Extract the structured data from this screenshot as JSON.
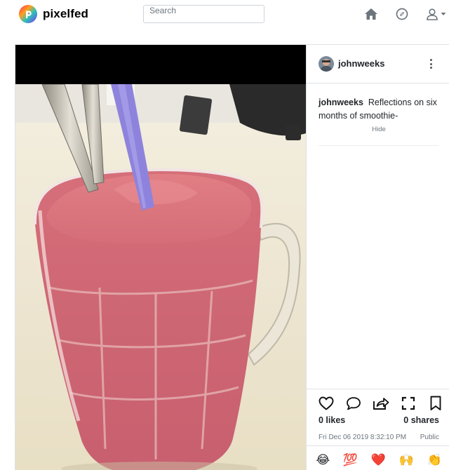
{
  "navbar": {
    "brand": "pixelfed",
    "search": {
      "placeholder": "Search"
    },
    "icons": [
      "home-icon",
      "explore-compass-icon",
      "user-icon",
      "caret-down-icon"
    ]
  },
  "post": {
    "username": "johnweeks",
    "caption_user": "johnweeks",
    "caption_text": "Reflections on six months of smoothie-",
    "hide_label": "Hide",
    "likes": "0 likes",
    "shares": "0 shares",
    "timestamp": "Fri Dec 06 2019 8:32:10 PM",
    "visibility": "Public",
    "action_icons": [
      "heart-icon",
      "comment-icon",
      "share-icon",
      "expand-icon",
      "bookmark-icon"
    ],
    "reactions": [
      {
        "name": "laughing-emoji",
        "glyph": "😂"
      },
      {
        "name": "hundred-emoji",
        "glyph": "💯"
      },
      {
        "name": "heart-emoji",
        "glyph": "❤️"
      },
      {
        "name": "raised-hands-emoji",
        "glyph": "🙌"
      },
      {
        "name": "clapping-emoji",
        "glyph": "👏"
      }
    ]
  },
  "colors": {
    "icon": "#6c757d",
    "text": "#212529",
    "muted": "#6c757d",
    "border": "#dee2e6"
  }
}
